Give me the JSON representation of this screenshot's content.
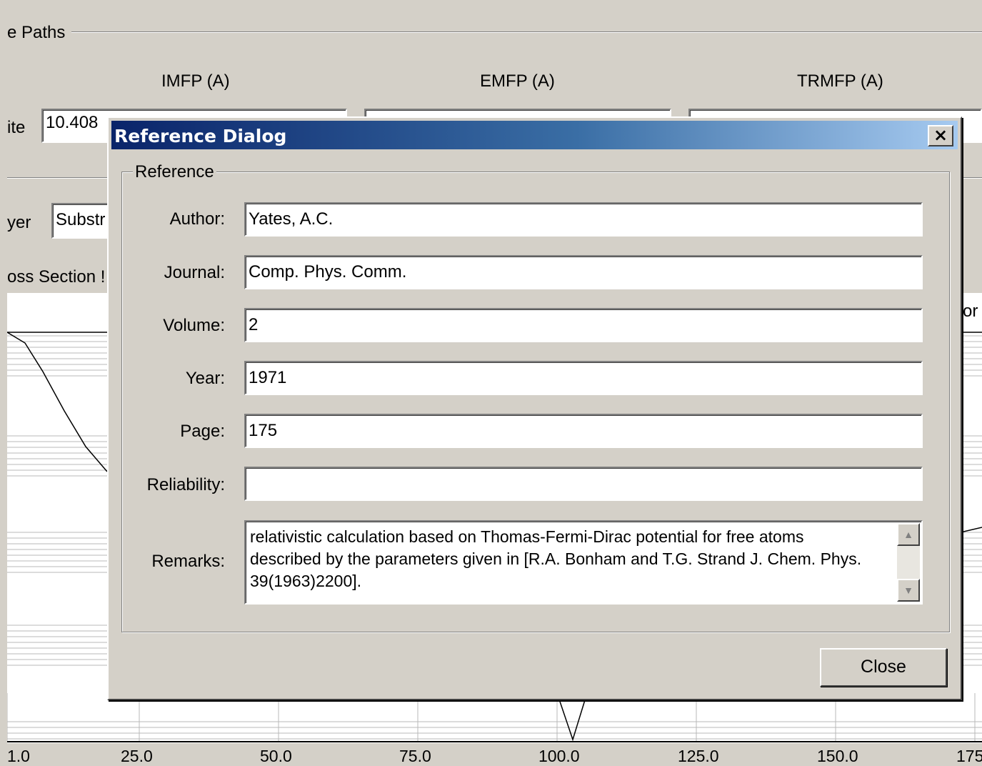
{
  "background": {
    "group_label": "e Paths",
    "columns": [
      "IMFP (A)",
      "EMFP (A)",
      "TRMFP (A)"
    ],
    "row_label": "ite",
    "imfp_value": "10.408",
    "layer_label": "yer",
    "layer_value": "Substr",
    "cross_section_label": "oss Section !",
    "right_fragment": "or",
    "x_ticks": [
      "1.0",
      "25.0",
      "50.0",
      "75.0",
      "100.0",
      "125.0",
      "150.0",
      "175"
    ]
  },
  "chart_data": {
    "type": "line",
    "x_ticks": [
      "1.0",
      "25.0",
      "50.0",
      "75.0",
      "100.0",
      "125.0",
      "150.0",
      "175"
    ],
    "grid": true,
    "note_visible": "plot mostly hidden behind dialog"
  },
  "dialog": {
    "title": "Reference Dialog",
    "close_glyph": "×",
    "group_label": "Reference",
    "fields": [
      {
        "label": "Author:",
        "value": "Yates, A.C."
      },
      {
        "label": "Journal:",
        "value": "Comp. Phys. Comm."
      },
      {
        "label": "Volume:",
        "value": "2"
      },
      {
        "label": "Year:",
        "value": "1971"
      },
      {
        "label": "Page:",
        "value": "175"
      },
      {
        "label": "Reliability:",
        "value": ""
      }
    ],
    "remarks_label": "Remarks:",
    "remarks": "relativistic calculation based on Thomas-Fermi-Dirac potential for free atoms described by the parameters given in [R.A. Bonham and T.G. Strand J. Chem. Phys. 39(1963)2200].",
    "close_label": "Close"
  }
}
